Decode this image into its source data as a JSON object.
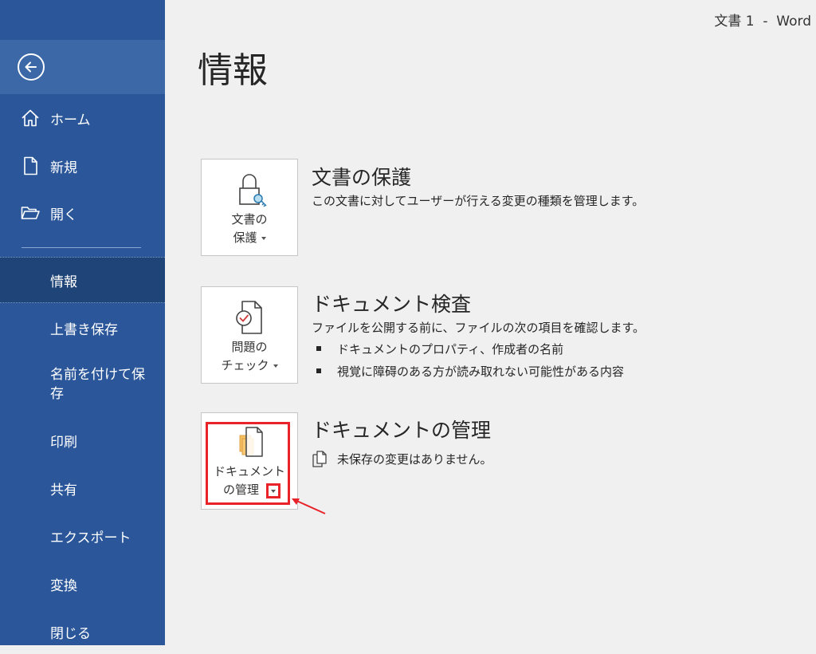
{
  "window": {
    "title": "文書 1  -  Word"
  },
  "sidebar": {
    "back_label": "戻る",
    "items": [
      {
        "label": "ホーム",
        "icon": "home-icon"
      },
      {
        "label": "新規",
        "icon": "new-document-icon"
      },
      {
        "label": "開く",
        "icon": "folder-open-icon"
      },
      {
        "label": "情報",
        "active": true
      },
      {
        "label": "上書き保存"
      },
      {
        "label": "名前を付けて保存"
      },
      {
        "label": "印刷"
      },
      {
        "label": "共有"
      },
      {
        "label": "エクスポート"
      },
      {
        "label": "変換"
      },
      {
        "label": "閉じる"
      }
    ]
  },
  "main": {
    "title": "情報",
    "sections": [
      {
        "button_line1": "文書の",
        "button_line2": "保護",
        "icon": "lock-key-icon",
        "title": "文書の保護",
        "description": "この文書に対してユーザーが行える変更の種類を管理します。"
      },
      {
        "button_line1": "問題の",
        "button_line2": "チェック",
        "icon": "document-check-icon",
        "title": "ドキュメント検査",
        "description": "ファイルを公開する前に、ファイルの次の項目を確認します。",
        "bullets": [
          "ドキュメントのプロパティ、作成者の名前",
          "視覚に障碍のある方が読み取れない可能性がある内容"
        ]
      },
      {
        "button_line1": "ドキュメント",
        "button_line2": "の管理",
        "icon": "manage-document-icon",
        "title": "ドキュメントの管理",
        "status": "未保存の変更はありません。"
      }
    ]
  },
  "colors": {
    "sidebar": "#2b579a",
    "sidebar_active": "#1f4478",
    "highlight": "#e8232a"
  }
}
